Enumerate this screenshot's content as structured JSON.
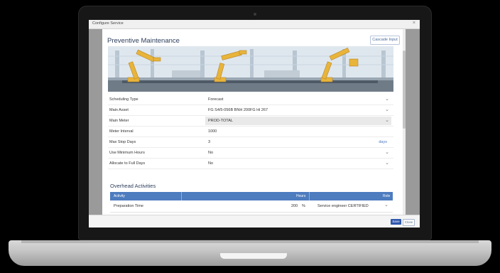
{
  "window": {
    "title": "Configure Service",
    "close_glyph": "×"
  },
  "header": {
    "title": "Preventive Maintenance",
    "cascade_button": "Cascade Input"
  },
  "form": {
    "rows": [
      {
        "label": "Scheduling Type",
        "value": "Forecast",
        "dropdown": true
      },
      {
        "label": "Main Asset",
        "value": "FG S4/5-056B BNH 200FG Hi 267",
        "dropdown": true
      },
      {
        "label": "Main Meter",
        "value": "PROD-TOTAL",
        "dropdown": true,
        "disabled": true
      },
      {
        "label": "Meter Interval",
        "value": "1000",
        "dropdown": false
      },
      {
        "label": "Max Stop Days",
        "value": "3",
        "dropdown": false,
        "unit": "days"
      },
      {
        "label": "Use Minimum Hours",
        "value": "No",
        "dropdown": true
      },
      {
        "label": "Allocate to Full Days",
        "value": "No",
        "dropdown": true
      }
    ]
  },
  "overhead": {
    "title": "Overhead Activities",
    "columns": {
      "activity": "Activity",
      "hours": "Hours",
      "role": "Role"
    },
    "rows": [
      {
        "activity": "Preparation Time",
        "hours": "200",
        "unit": "%",
        "role": "Service engineer CERTIFIED"
      }
    ]
  },
  "footer": {
    "save": "Save",
    "close": "Close"
  },
  "icons": {
    "dropdown": "chevron-down-icon"
  },
  "colors": {
    "accent": "#4d7cbf",
    "title": "#2d3e5c",
    "primary_button": "#2f58ae"
  }
}
